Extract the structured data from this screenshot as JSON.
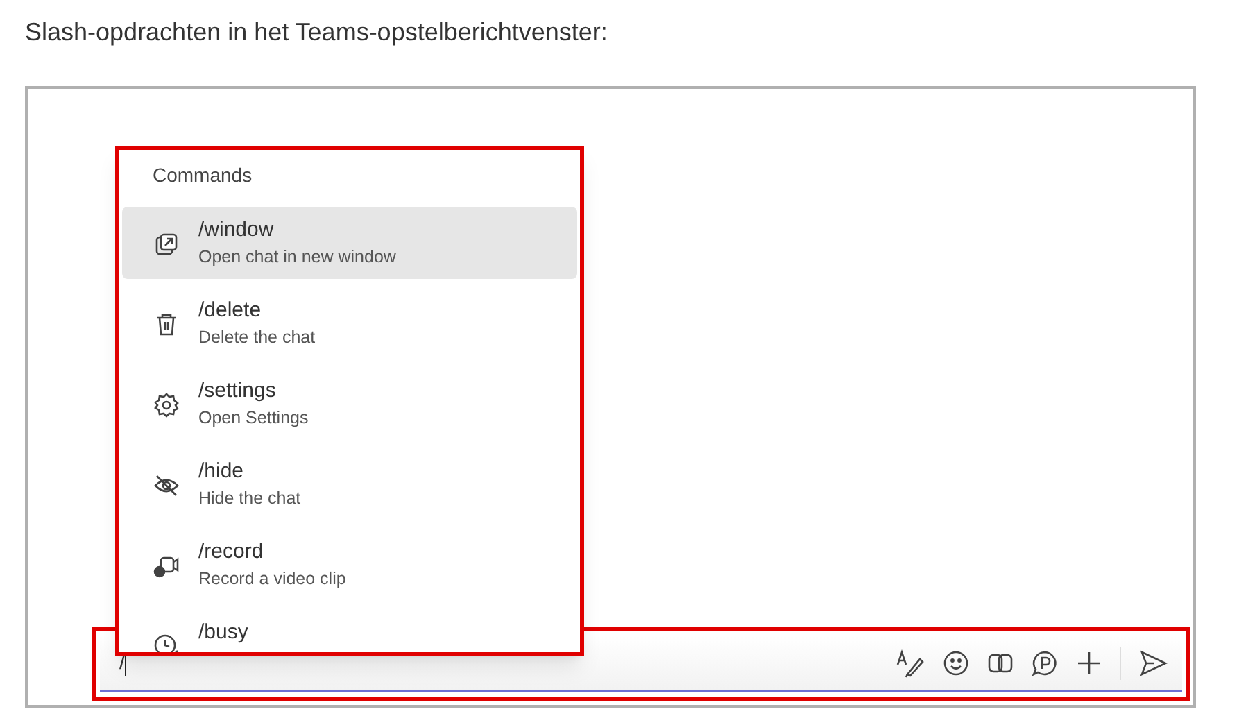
{
  "caption": "Slash-opdrachten in het Teams-opstelberichtvenster:",
  "menu": {
    "title": "Commands",
    "items": [
      {
        "command": "/window",
        "description": "Open chat in new window",
        "selected": true
      },
      {
        "command": "/delete",
        "description": "Delete the chat",
        "selected": false
      },
      {
        "command": "/settings",
        "description": "Open Settings",
        "selected": false
      },
      {
        "command": "/hide",
        "description": "Hide the chat",
        "selected": false
      },
      {
        "command": "/record",
        "description": "Record a video clip",
        "selected": false
      },
      {
        "command": "/busy",
        "selected": false
      }
    ]
  },
  "composer": {
    "value": "/"
  }
}
